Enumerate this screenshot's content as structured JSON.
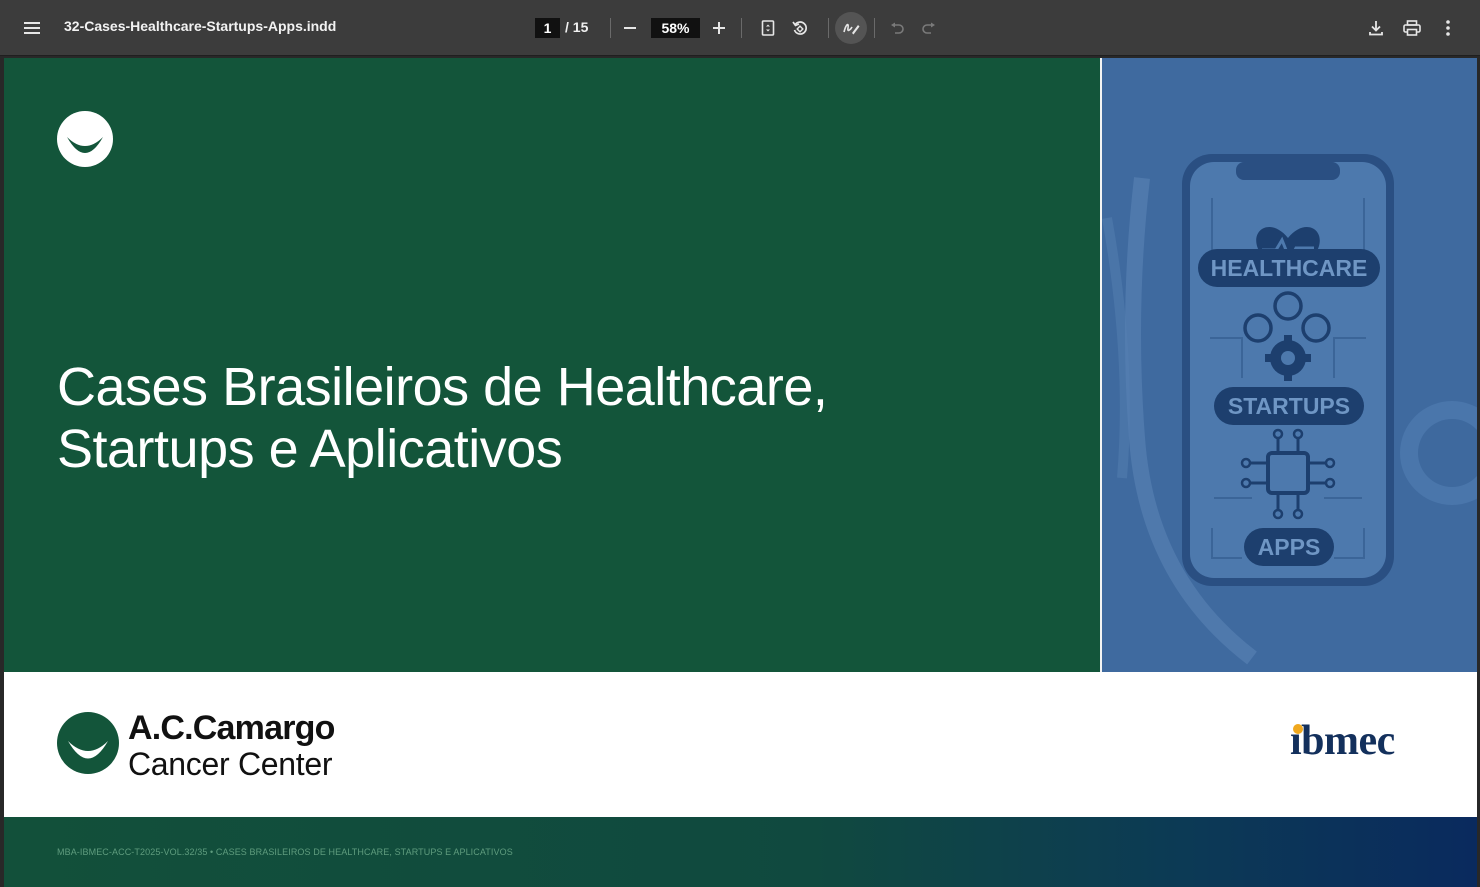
{
  "toolbar": {
    "file_name": "32-Cases-Healthcare-Startups-Apps.indd",
    "current_page": "1",
    "total_pages": "/ 15",
    "zoom": "58%"
  },
  "icons": {
    "menu": "menu-icon",
    "zoom_out": "minus-icon",
    "zoom_in": "plus-icon",
    "fit_page": "fit-page-icon",
    "rotate": "rotate-icon",
    "annotate": "pen-icon",
    "undo": "undo-icon",
    "redo": "redo-icon",
    "download": "download-icon",
    "print": "print-icon",
    "more": "more-vert-icon"
  },
  "document": {
    "headline_line1": "Cases Brasileiros de Healthcare,",
    "headline_line2": "Startups e Aplicativos",
    "phone_labels": {
      "healthcare": "HEALTHCARE",
      "startups": "STARTUPS",
      "apps": "APPS"
    },
    "sponsor_name": "A.C.Camargo",
    "sponsor_sub": "Cancer Center",
    "partner": "ıbmec",
    "footer": "MBA-IBMEC-ACC-T2025-VOL.32/35 • CASES BRASILEIROS DE HEALTHCARE, STARTUPS E APLICATIVOS"
  },
  "colors": {
    "green_panel": "#13553a",
    "blue_panel": "#3f6a9f",
    "ibmec_navy": "#13305c",
    "ibmec_accent": "#f0a81e"
  }
}
